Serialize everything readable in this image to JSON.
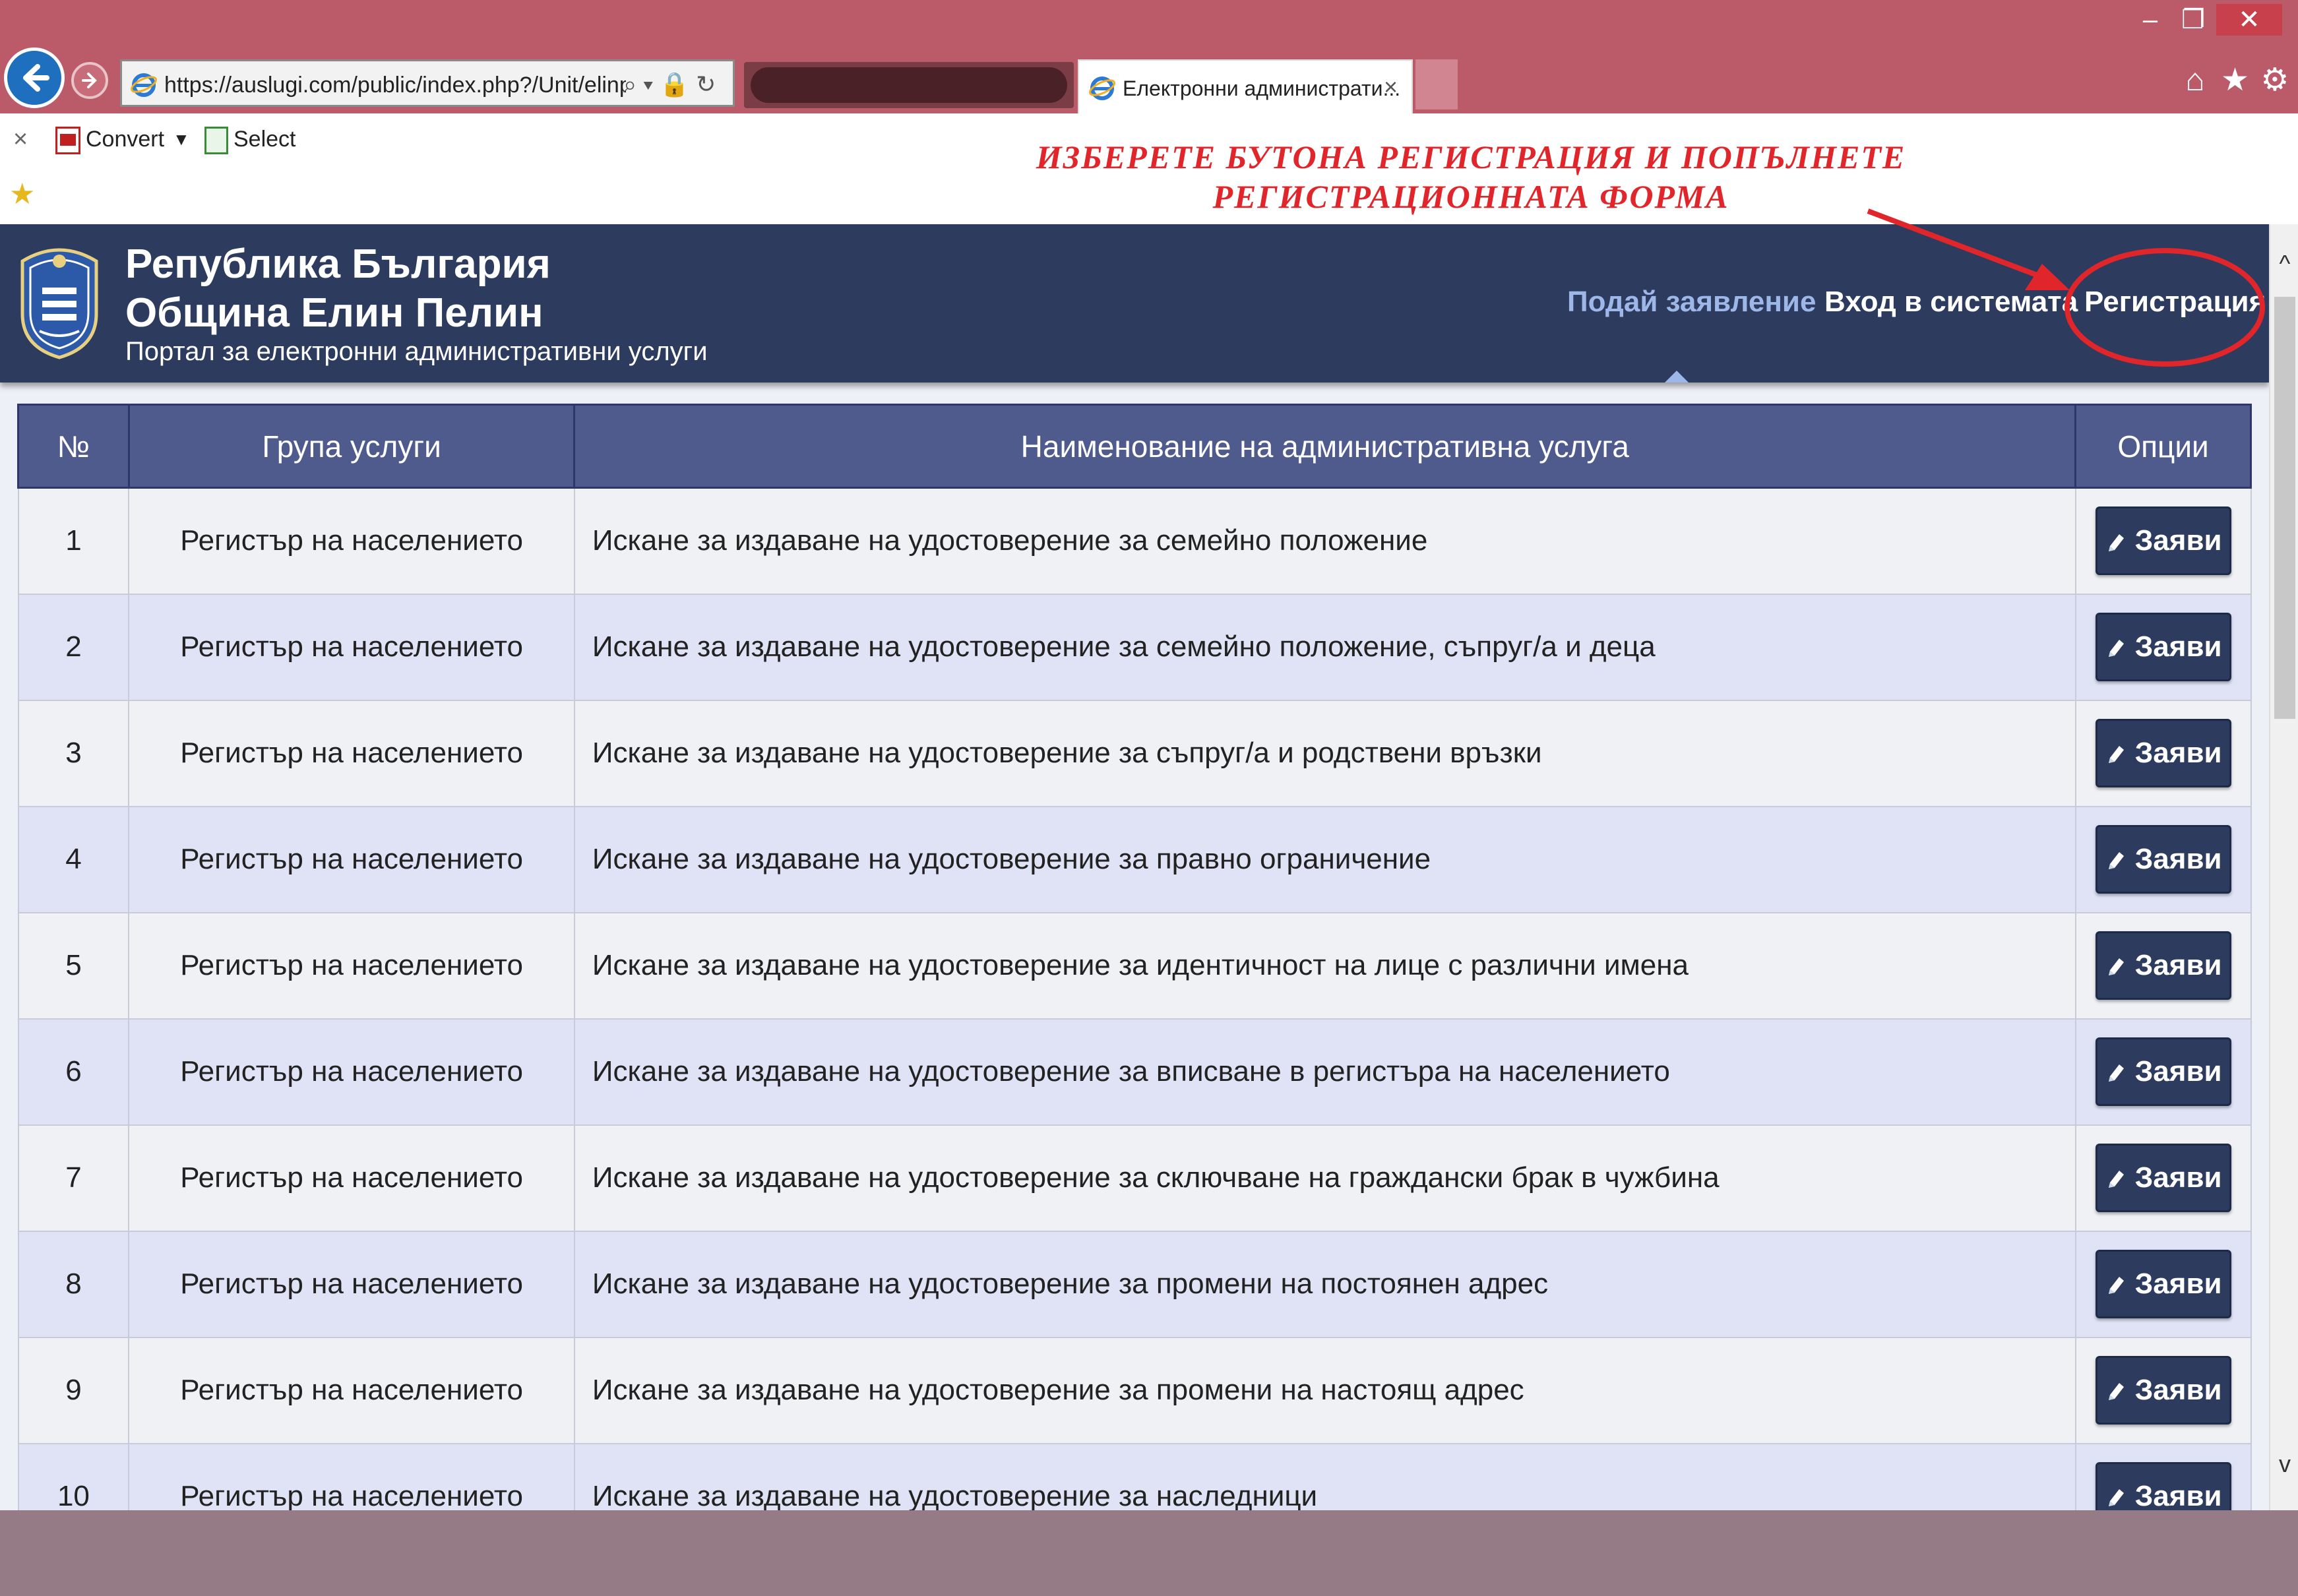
{
  "browser": {
    "window_buttons": {
      "minimize": "–",
      "maximize": "❐",
      "close": "✕"
    },
    "address_url": "https://auslugi.com/public/index.php?/Unit/elinpe",
    "address_icons": "⌕ ▾ 🔒 ↻",
    "tab_active_title": "Електронни администрати...",
    "tab_close": "×",
    "toolbar_icons": [
      "home-icon",
      "star-icon",
      "gear-icon"
    ],
    "home_glyph": "⌂",
    "star_glyph": "★",
    "gear_glyph": "⚙"
  },
  "command_bar": {
    "close": "×",
    "convert_label": "Convert",
    "dropdown": "▼",
    "select_label": "Select",
    "favorites_glyph": "★"
  },
  "instruction": {
    "line1": "ИЗБЕРЕТЕ БУТОНА РЕГИСТРАЦИЯ И ПОПЪЛНЕТЕ",
    "line2": "РЕГИСТРАЦИОННАТА ФОРМА",
    "color": "#e0262a"
  },
  "header": {
    "title_line1": "Република България",
    "title_line2": "Община Елин Пелин",
    "subtitle": "Портал за електронни административни услуги",
    "nav": {
      "apply": "Подай заявление",
      "login": "Вход в системата",
      "register": "Регистрация"
    },
    "background": "#2d3c5e"
  },
  "scroll": {
    "up": "^",
    "down": "v"
  },
  "table": {
    "headers": [
      "№",
      "Група услуги",
      "Наименование на административна услуга",
      "Опции"
    ],
    "button_label": "Заяви",
    "rows": [
      {
        "num": "1",
        "group": "Регистър на населението",
        "name": "Искане за издаване на удостоверение за семейно положение"
      },
      {
        "num": "2",
        "group": "Регистър на населението",
        "name": "Искане за издаване на удостоверение за семейно положение, съпруг/а и деца"
      },
      {
        "num": "3",
        "group": "Регистър на населението",
        "name": "Искане за издаване на удостоверение за съпруг/а и родствени връзки"
      },
      {
        "num": "4",
        "group": "Регистър на населението",
        "name": "Искане за издаване на удостоверение за правно ограничение"
      },
      {
        "num": "5",
        "group": "Регистър на населението",
        "name": "Искане за издаване на удостоверение за идентичност на лице с различни имена"
      },
      {
        "num": "6",
        "group": "Регистър на населението",
        "name": "Искане за издаване на удостоверение за вписване в регистъра на населението"
      },
      {
        "num": "7",
        "group": "Регистър на населението",
        "name": "Искане за издаване на удостоверение за сключване на граждански брак в чужбина"
      },
      {
        "num": "8",
        "group": "Регистър на населението",
        "name": "Искане за издаване на удостоверение за промени на постоянен адрес"
      },
      {
        "num": "9",
        "group": "Регистър на населението",
        "name": "Искане за издаване на удостоверение за промени на настоящ адрес"
      },
      {
        "num": "10",
        "group": "Регистър на населението",
        "name": "Искане за издаване на удостоверение за наследници"
      }
    ]
  }
}
